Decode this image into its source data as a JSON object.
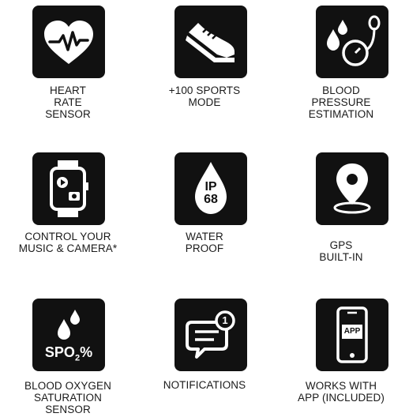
{
  "colors": {
    "tile": "#111111",
    "icon": "#ffffff",
    "text": "#1a1a1a"
  },
  "features": [
    {
      "icon": "heart-rate-icon",
      "lines": [
        "HEART",
        "RATE",
        "SENSOR"
      ]
    },
    {
      "icon": "sneaker-icon",
      "lines": [
        "+100 SPORTS",
        "MODE"
      ]
    },
    {
      "icon": "blood-pressure-icon",
      "lines": [
        "BLOOD",
        "PRESSURE",
        "ESTIMATION"
      ]
    },
    {
      "icon": "smartwatch-media-icon",
      "lines": [
        "CONTROL YOUR",
        "MUSIC & CAMERA*"
      ]
    },
    {
      "icon": "water-drop-ip68-icon",
      "badge": "IP\n68",
      "lines": [
        "WATER",
        "PROOF"
      ]
    },
    {
      "icon": "gps-pin-icon",
      "lines": [
        "GPS",
        "BUILT-IN"
      ]
    },
    {
      "icon": "blood-oxygen-icon",
      "badge_main": "SPO",
      "badge_sub": "2",
      "badge_pct": "%",
      "lines": [
        "BLOOD OXYGEN",
        "SATURATION",
        "SENSOR"
      ]
    },
    {
      "icon": "notification-bubble-icon",
      "badge": "1",
      "lines": [
        "NOTIFICATIONS"
      ]
    },
    {
      "icon": "phone-app-icon",
      "badge": "APP",
      "lines": [
        "WORKS WITH",
        "APP (INCLUDED)"
      ]
    }
  ]
}
